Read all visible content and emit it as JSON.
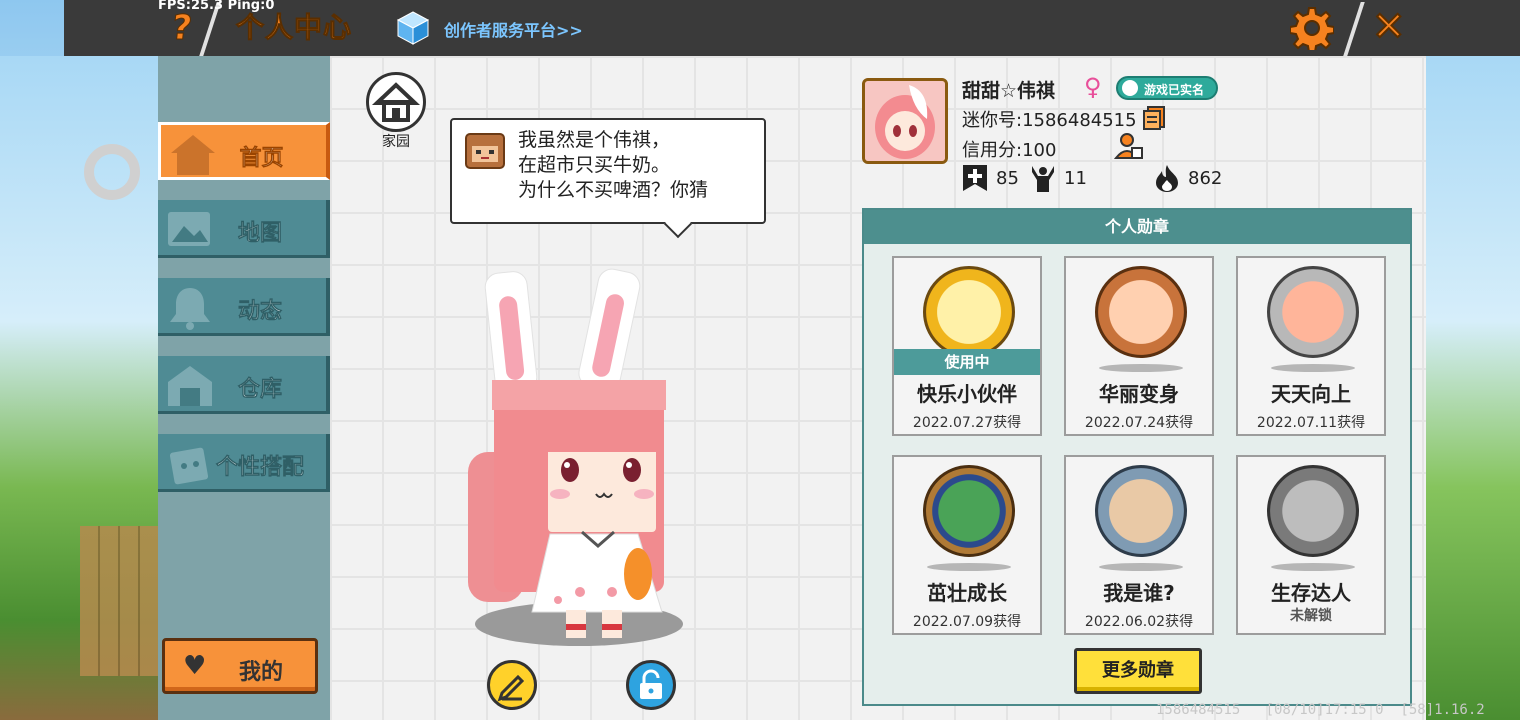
{
  "debug": {
    "fps": "FPS:25.3  Ping:0"
  },
  "header": {
    "help_label": "?",
    "title": "个人中心",
    "creator_link": "创作者服务平台>>",
    "close_label": "✕"
  },
  "sidebar": {
    "items": [
      {
        "label": "首页",
        "icon": "house-icon",
        "active": true
      },
      {
        "label": "地图",
        "icon": "picture-icon",
        "active": false
      },
      {
        "label": "动态",
        "icon": "bell-icon",
        "active": false
      },
      {
        "label": "仓库",
        "icon": "storage-icon",
        "active": false
      },
      {
        "label": "个性搭配",
        "icon": "outfit-icon",
        "active": false
      }
    ],
    "mine_label": "我的",
    "mine_icon": "♥"
  },
  "home": {
    "label": "家园"
  },
  "speech": {
    "lines": [
      "我虽然是个伟祺，",
      "在超市只买牛奶。",
      "为什么不买啤酒？你猜"
    ]
  },
  "profile": {
    "username": "甜甜☆伟祺",
    "gender_symbol": "♀",
    "verified_label": "游戏已实名",
    "mini_id": "迷你号:1586484515",
    "credit": "信用分:100",
    "stats": [
      {
        "icon": "bookmark-plus-icon",
        "value": "85"
      },
      {
        "icon": "cheer-icon",
        "value": "11"
      },
      {
        "icon": "flame-icon",
        "value": "862"
      }
    ]
  },
  "badges": {
    "header": "个人勋章",
    "in_use_label": "使用中",
    "items": [
      {
        "name": "快乐小伙伴",
        "date": "2022.07.27获得",
        "in_use": true,
        "color": "#f0b51c"
      },
      {
        "name": "华丽变身",
        "date": "2022.07.24获得",
        "in_use": false,
        "color": "#c8733b"
      },
      {
        "name": "天天向上",
        "date": "2022.07.11获得",
        "in_use": false,
        "color": "#9a9a9a"
      },
      {
        "name": "茁壮成长",
        "date": "2022.07.09获得",
        "in_use": false,
        "color": "#b07a36"
      },
      {
        "name": "我是谁?",
        "date": "2022.06.02获得",
        "in_use": false,
        "color": "#7f9bb3"
      },
      {
        "name": "生存达人",
        "status": "未解锁",
        "in_use": false,
        "color": "#8d8d8d"
      }
    ],
    "more_label": "更多勋章"
  },
  "footer": {
    "info": "1586484515   [08/10]17:15 0  [58]1.16.2"
  },
  "colors": {
    "accent": "#f6821f",
    "nav": "#4f8b94",
    "badge_header": "#4d8f8e"
  }
}
